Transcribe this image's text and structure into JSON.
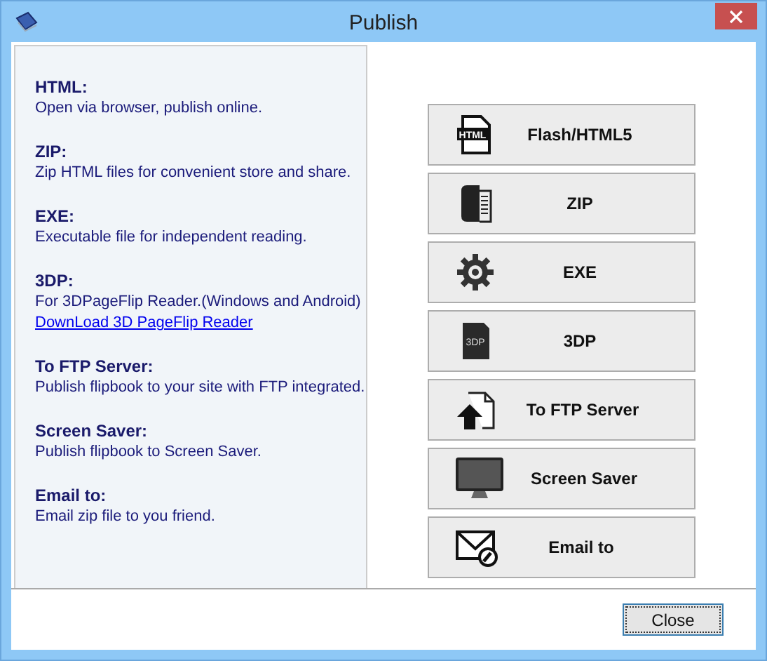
{
  "window": {
    "title": "Publish"
  },
  "sections": [
    {
      "title": "HTML:",
      "description": "Open via browser, publish online."
    },
    {
      "title": "ZIP:",
      "description": "Zip HTML files for convenient store and share."
    },
    {
      "title": "EXE:",
      "description": "Executable file for independent reading."
    },
    {
      "title": "3DP:",
      "description": "For 3DPageFlip Reader.(Windows and Android)",
      "link": "DownLoad 3D PageFlip Reader"
    },
    {
      "title": "To FTP Server:",
      "description": "Publish flipbook to your site with FTP integrated."
    },
    {
      "title": "Screen Saver:",
      "description": "Publish flipbook to Screen Saver."
    },
    {
      "title": "Email to:",
      "description": "Email zip file to you friend."
    }
  ],
  "buttons": [
    {
      "kind": "html",
      "icon_text": "HTML",
      "label": "Flash/HTML5"
    },
    {
      "kind": "zip",
      "label": "ZIP"
    },
    {
      "kind": "exe",
      "label": "EXE"
    },
    {
      "kind": "pageflip",
      "icon_text": "3DP",
      "label": "3DP"
    },
    {
      "kind": "ftp",
      "label": "To FTP Server"
    },
    {
      "kind": "screensaver",
      "label": "Screen Saver"
    },
    {
      "kind": "email",
      "label": "Email to"
    }
  ],
  "close_button": "Close"
}
